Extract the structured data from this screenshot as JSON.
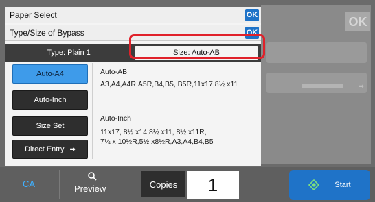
{
  "background": {
    "ok_label": "OK",
    "arrow": "➡"
  },
  "dialog": {
    "paper_select_title": "Paper Select",
    "bypass_title": "Type/Size of Bypass",
    "ok_label": "OK",
    "type_tab": "Type:  Plain 1",
    "size_tab": "Size:  Auto-AB",
    "buttons": {
      "auto_a4": "Auto-A4",
      "auto_inch": "Auto-Inch",
      "size_set": "Size Set",
      "direct_entry": "Direct Entry",
      "direct_entry_arrow": "➡"
    },
    "auto_ab": {
      "title": "Auto-AB",
      "sizes": "A3,A4,A4R,A5R,B4,B5, B5R,11x17,8½ x11"
    },
    "auto_inch": {
      "title": "Auto-Inch",
      "sizes_line1": "11x17, 8½ x14,8½ x11, 8½ x11R,",
      "sizes_line2": "7¼ x 10½R,5½ x8½R,A3,A4,B4,B5"
    },
    "highlight_color": "#e0212a"
  },
  "bottom_bar": {
    "ca": "CA",
    "preview": "Preview",
    "preview_icon": "magnifier-icon",
    "copies_label": "Copies",
    "copies_value": "1",
    "start": "Start",
    "start_icon": "diamond-start-icon",
    "accent": "#1f73c8"
  }
}
